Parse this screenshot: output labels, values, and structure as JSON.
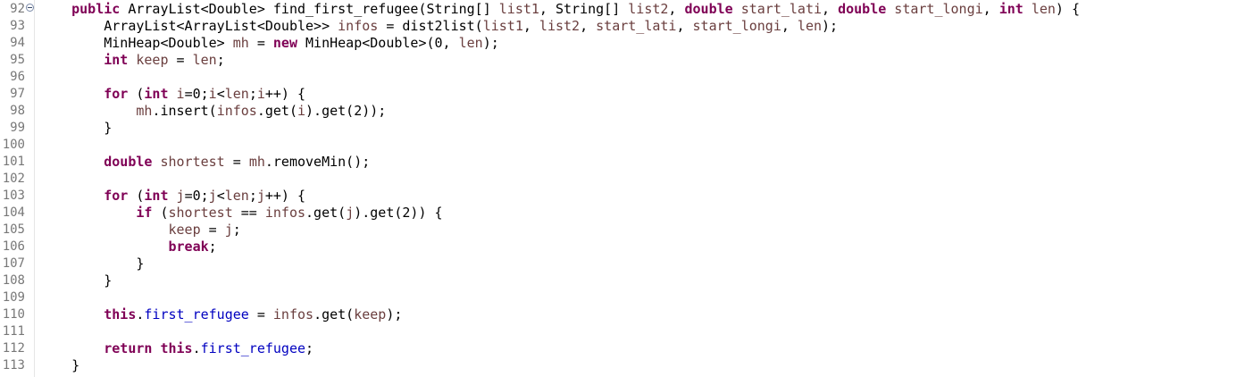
{
  "editor": {
    "language": "java",
    "colors": {
      "keyword": "#7f0055",
      "variable": "#6a3e3e",
      "field": "#0000c0",
      "plain": "#000000",
      "line_number": "#787878"
    },
    "fold_marker_icon": "collapse-icon",
    "lines": [
      {
        "num": "92",
        "fold": true,
        "tokens": [
          {
            "t": "    "
          },
          {
            "t": "public",
            "k": "kw"
          },
          {
            "t": " ArrayList<Double> find_first_refugee(String[] "
          },
          {
            "t": "list1",
            "k": "var"
          },
          {
            "t": ", String[] "
          },
          {
            "t": "list2",
            "k": "var"
          },
          {
            "t": ", "
          },
          {
            "t": "double",
            "k": "kw"
          },
          {
            "t": " "
          },
          {
            "t": "start_lati",
            "k": "var"
          },
          {
            "t": ", "
          },
          {
            "t": "double",
            "k": "kw"
          },
          {
            "t": " "
          },
          {
            "t": "start_longi",
            "k": "var"
          },
          {
            "t": ", "
          },
          {
            "t": "int",
            "k": "kw"
          },
          {
            "t": " "
          },
          {
            "t": "len",
            "k": "var"
          },
          {
            "t": ") {"
          }
        ]
      },
      {
        "num": "93",
        "tokens": [
          {
            "t": "        ArrayList<ArrayList<Double>> "
          },
          {
            "t": "infos",
            "k": "var"
          },
          {
            "t": " = dist2list("
          },
          {
            "t": "list1",
            "k": "var"
          },
          {
            "t": ", "
          },
          {
            "t": "list2",
            "k": "var"
          },
          {
            "t": ", "
          },
          {
            "t": "start_lati",
            "k": "var"
          },
          {
            "t": ", "
          },
          {
            "t": "start_longi",
            "k": "var"
          },
          {
            "t": ", "
          },
          {
            "t": "len",
            "k": "var"
          },
          {
            "t": ");"
          }
        ]
      },
      {
        "num": "94",
        "tokens": [
          {
            "t": "        MinHeap<Double> "
          },
          {
            "t": "mh",
            "k": "var"
          },
          {
            "t": " = "
          },
          {
            "t": "new",
            "k": "kw"
          },
          {
            "t": " MinHeap<Double>(0, "
          },
          {
            "t": "len",
            "k": "var"
          },
          {
            "t": ");"
          }
        ]
      },
      {
        "num": "95",
        "tokens": [
          {
            "t": "        "
          },
          {
            "t": "int",
            "k": "kw"
          },
          {
            "t": " "
          },
          {
            "t": "keep",
            "k": "var"
          },
          {
            "t": " = "
          },
          {
            "t": "len",
            "k": "var"
          },
          {
            "t": ";"
          }
        ]
      },
      {
        "num": "96",
        "tokens": []
      },
      {
        "num": "97",
        "tokens": [
          {
            "t": "        "
          },
          {
            "t": "for",
            "k": "kw"
          },
          {
            "t": " ("
          },
          {
            "t": "int",
            "k": "kw"
          },
          {
            "t": " "
          },
          {
            "t": "i",
            "k": "var"
          },
          {
            "t": "=0;"
          },
          {
            "t": "i",
            "k": "var"
          },
          {
            "t": "<"
          },
          {
            "t": "len",
            "k": "var"
          },
          {
            "t": ";"
          },
          {
            "t": "i",
            "k": "var"
          },
          {
            "t": "++) {"
          }
        ]
      },
      {
        "num": "98",
        "tokens": [
          {
            "t": "            "
          },
          {
            "t": "mh",
            "k": "var"
          },
          {
            "t": ".insert("
          },
          {
            "t": "infos",
            "k": "var"
          },
          {
            "t": ".get("
          },
          {
            "t": "i",
            "k": "var"
          },
          {
            "t": ").get(2));"
          }
        ]
      },
      {
        "num": "99",
        "tokens": [
          {
            "t": "        }"
          }
        ]
      },
      {
        "num": "100",
        "tokens": []
      },
      {
        "num": "101",
        "tokens": [
          {
            "t": "        "
          },
          {
            "t": "double",
            "k": "kw"
          },
          {
            "t": " "
          },
          {
            "t": "shortest",
            "k": "var"
          },
          {
            "t": " = "
          },
          {
            "t": "mh",
            "k": "var"
          },
          {
            "t": ".removeMin();"
          }
        ]
      },
      {
        "num": "102",
        "tokens": []
      },
      {
        "num": "103",
        "tokens": [
          {
            "t": "        "
          },
          {
            "t": "for",
            "k": "kw"
          },
          {
            "t": " ("
          },
          {
            "t": "int",
            "k": "kw"
          },
          {
            "t": " "
          },
          {
            "t": "j",
            "k": "var"
          },
          {
            "t": "=0;"
          },
          {
            "t": "j",
            "k": "var"
          },
          {
            "t": "<"
          },
          {
            "t": "len",
            "k": "var"
          },
          {
            "t": ";"
          },
          {
            "t": "j",
            "k": "var"
          },
          {
            "t": "++) {"
          }
        ]
      },
      {
        "num": "104",
        "tokens": [
          {
            "t": "            "
          },
          {
            "t": "if",
            "k": "kw"
          },
          {
            "t": " ("
          },
          {
            "t": "shortest",
            "k": "var"
          },
          {
            "t": " == "
          },
          {
            "t": "infos",
            "k": "var"
          },
          {
            "t": ".get("
          },
          {
            "t": "j",
            "k": "var"
          },
          {
            "t": ").get(2)) {"
          }
        ]
      },
      {
        "num": "105",
        "tokens": [
          {
            "t": "                "
          },
          {
            "t": "keep",
            "k": "var"
          },
          {
            "t": " = "
          },
          {
            "t": "j",
            "k": "var"
          },
          {
            "t": ";"
          }
        ]
      },
      {
        "num": "106",
        "tokens": [
          {
            "t": "                "
          },
          {
            "t": "break",
            "k": "kw"
          },
          {
            "t": ";"
          }
        ]
      },
      {
        "num": "107",
        "tokens": [
          {
            "t": "            }"
          }
        ]
      },
      {
        "num": "108",
        "tokens": [
          {
            "t": "        }"
          }
        ]
      },
      {
        "num": "109",
        "tokens": []
      },
      {
        "num": "110",
        "tokens": [
          {
            "t": "        "
          },
          {
            "t": "this",
            "k": "kw"
          },
          {
            "t": "."
          },
          {
            "t": "first_refugee",
            "k": "fld"
          },
          {
            "t": " = "
          },
          {
            "t": "infos",
            "k": "var"
          },
          {
            "t": ".get("
          },
          {
            "t": "keep",
            "k": "var"
          },
          {
            "t": ");"
          }
        ]
      },
      {
        "num": "111",
        "tokens": []
      },
      {
        "num": "112",
        "tokens": [
          {
            "t": "        "
          },
          {
            "t": "return",
            "k": "kw"
          },
          {
            "t": " "
          },
          {
            "t": "this",
            "k": "kw"
          },
          {
            "t": "."
          },
          {
            "t": "first_refugee",
            "k": "fld"
          },
          {
            "t": ";"
          }
        ]
      },
      {
        "num": "113",
        "tokens": [
          {
            "t": "    }"
          }
        ]
      }
    ]
  }
}
